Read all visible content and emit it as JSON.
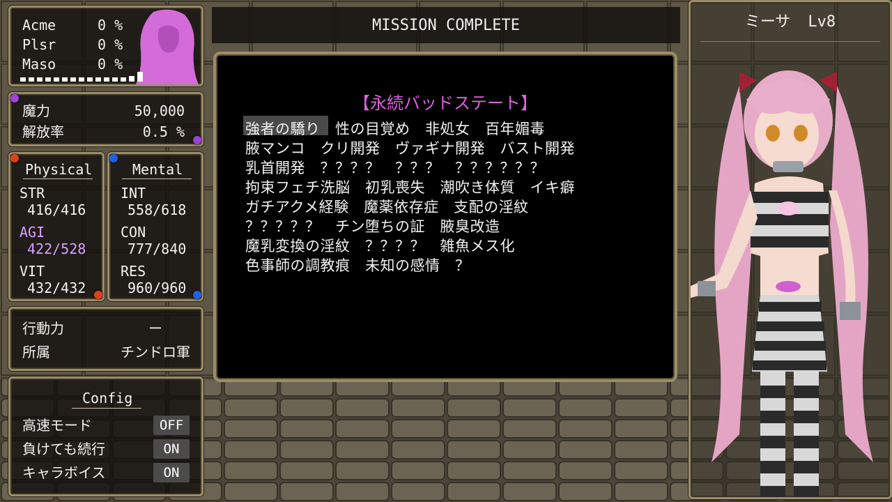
{
  "status": {
    "rows": [
      {
        "label": "Acme",
        "value": "0 %"
      },
      {
        "label": "Plsr",
        "value": "0 %"
      },
      {
        "label": "Maso",
        "value": "0 %"
      }
    ]
  },
  "magic": {
    "power_label": "魔力",
    "power_value": "50,000",
    "release_label": "解放率",
    "release_value": "0.5 %"
  },
  "physical": {
    "title": "Physical",
    "stats": [
      {
        "label": "STR",
        "value": "416/416"
      },
      {
        "label": "AGI",
        "value": "422/528"
      },
      {
        "label": "VIT",
        "value": "432/432"
      }
    ]
  },
  "mental": {
    "title": "Mental",
    "stats": [
      {
        "label": "INT",
        "value": "558/618"
      },
      {
        "label": "CON",
        "value": "777/840"
      },
      {
        "label": "RES",
        "value": "960/960"
      }
    ]
  },
  "info": {
    "action_label": "行動力",
    "action_value": "ー",
    "affiliation_label": "所属",
    "affiliation_value": "チンドロ軍"
  },
  "config": {
    "title": "Config",
    "items": [
      {
        "label": "高速モード",
        "value": "OFF"
      },
      {
        "label": "負けても続行",
        "value": "ON"
      },
      {
        "label": "キャラボイス",
        "value": "ON"
      }
    ]
  },
  "mission": {
    "title": "MISSION COMPLETE"
  },
  "bad_states": {
    "heading": "【永続バッドステート】",
    "lines": [
      "強者の驕り　性の目覚め　非処女　百年媚毒",
      "腋マンコ　クリ開発　ヴァギナ開発　バスト開発",
      "乳首開発　？？？？　？？？　？？？？？？",
      "拘束フェチ洗脳　初乳喪失　潮吹き体質　イキ癖",
      "ガチアクメ経験　魔薬依存症　支配の淫紋",
      "？？？？？　チン堕ちの証　腋臭改造",
      "魔乳変換の淫紋　？？？？　雑魚メス化",
      "色事師の調教痕　未知の感情　？"
    ]
  },
  "character": {
    "name": "ミーサ",
    "level": "Lv8"
  },
  "colors": {
    "frame": "#9c8d68",
    "accent_pink": "#e060e0",
    "agi_highlight": "#d9a0ff",
    "silhouette": "#d36bd8"
  }
}
